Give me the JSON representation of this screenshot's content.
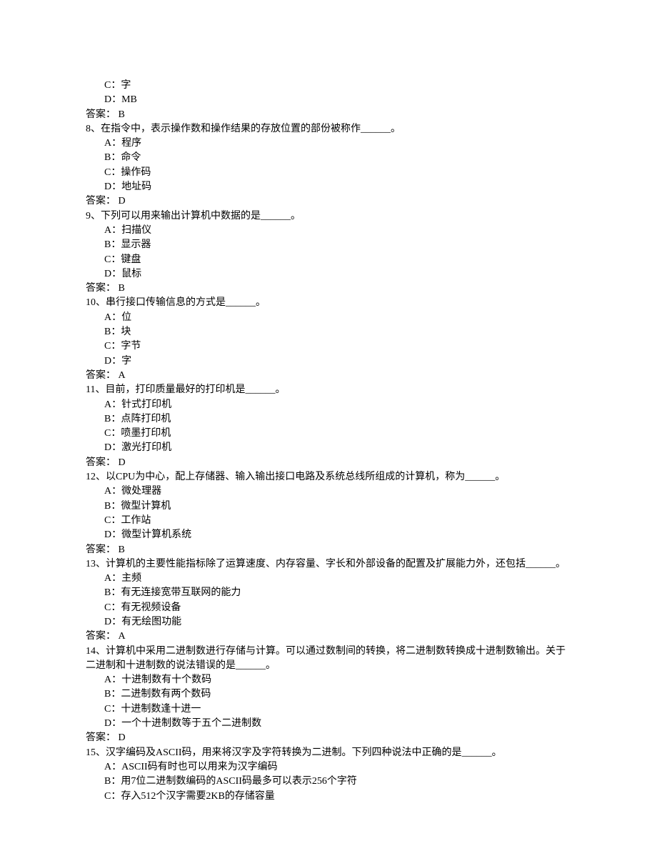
{
  "answerLabel": "答案：",
  "frag": {
    "optC": "C：字",
    "optD": "D：MB",
    "answer": " B"
  },
  "questions": [
    {
      "num": "8、",
      "stem_a": "在指令中，表示操作数和操作结果的存放位置的部份被称作",
      "stem_b": "。",
      "opts": [
        "A：程序",
        "B：命令",
        "C：操作码",
        "D：地址码"
      ],
      "answer": " D"
    },
    {
      "num": "9、",
      "stem_a": "下列可以用来输出计算机中数据的是",
      "stem_b": "。",
      "opts": [
        "A：扫描仪",
        "B：显示器",
        "C：键盘",
        "D：鼠标"
      ],
      "answer": " B"
    },
    {
      "num": "10、",
      "stem_a": "串行接口传输信息的方式是",
      "stem_b": "。",
      "opts": [
        "A：位",
        "B：块",
        "C：字节",
        "D：字"
      ],
      "answer": " A"
    },
    {
      "num": "11、",
      "stem_a": "目前，打印质量最好的打印机是",
      "stem_b": "。",
      "opts": [
        "A：针式打印机",
        "B：点阵打印机",
        "C：喷墨打印机",
        "D：激光打印机"
      ],
      "answer": " D"
    },
    {
      "num": "12、",
      "stem_a": "以CPU为中心，配上存储器、输入输出接口电路及系统总线所组成的计算机，称为",
      "stem_b": "。",
      "opts": [
        "A：微处理器",
        "B：微型计算机",
        "C：工作站",
        "D：微型计算机系统"
      ],
      "answer": " B"
    },
    {
      "num": "13、",
      "stem_a": "计算机的主要性能指标除了运算速度、内存容量、字长和外部设备的配置及扩展能力外，还包括",
      "stem_b": "。",
      "opts": [
        "A：主频",
        "B：有无连接宽带互联网的能力",
        "C：有无视频设备",
        "D：有无绘图功能"
      ],
      "answer": " A"
    },
    {
      "num": "14、",
      "stem_a": "计算机中采用二进制数进行存储与计算。可以通过数制间的转换，将二进制数转换成十进制数输出。关于二进制和十进制数的说法错误的是",
      "stem_b": "。",
      "opts": [
        "A：十进制数有十个数码",
        "B：二进制数有两个数码",
        "C：十进制数逢十进一",
        "D：一个十进制数等于五个二进制数"
      ],
      "answer": " D"
    },
    {
      "num": "15、",
      "stem_a": "汉字编码及ASCII码，用来将汉字及字符转换为二进制。下列四种说法中正确的是",
      "stem_b": "。",
      "opts": [
        "A：ASCII码有时也可以用来为汉字编码",
        "B：用7位二进制数编码的ASCII码最多可以表示256个字符",
        "C：存入512个汉字需要2KB的存储容量"
      ],
      "answer": null
    }
  ]
}
